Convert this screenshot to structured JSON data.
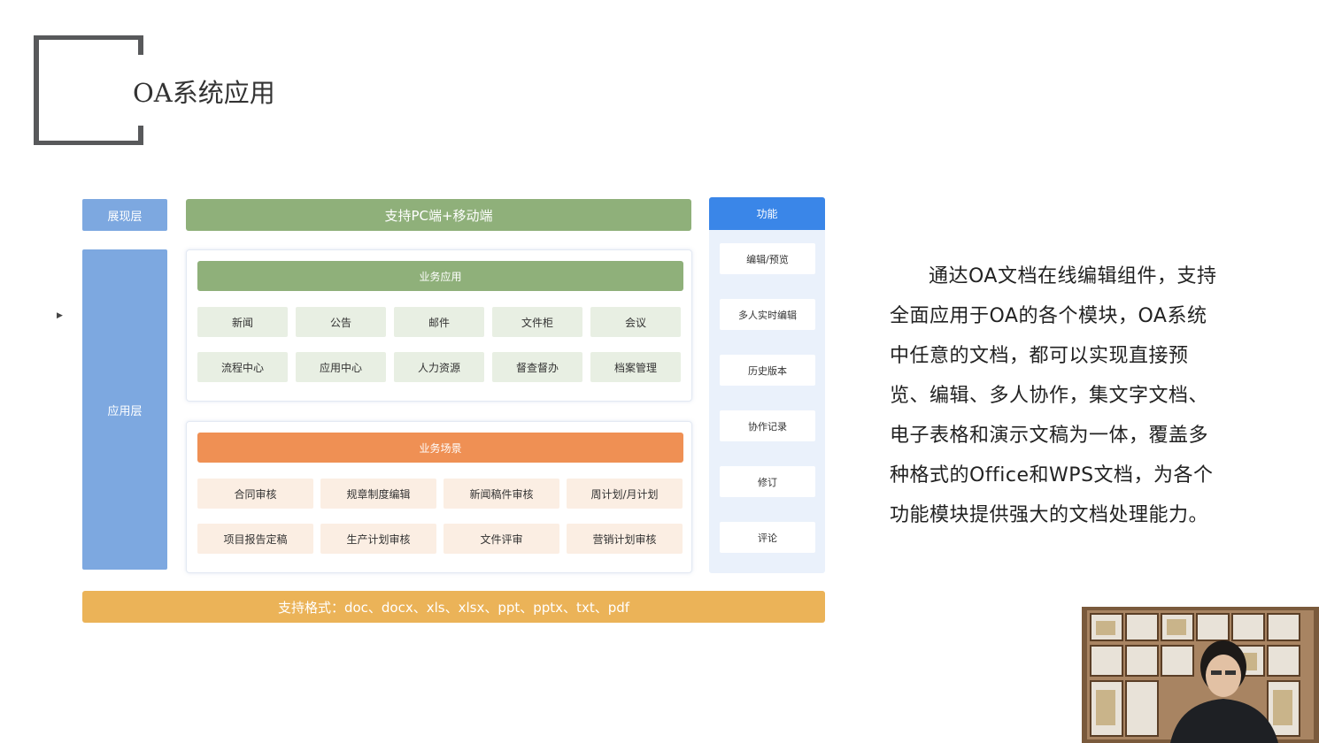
{
  "page": {
    "title": "OA系统应用"
  },
  "diagram": {
    "presentation_layer": "展现层",
    "application_layer": "应用层",
    "support_pc": "支持PC端+移动端",
    "business_apps": {
      "title": "业务应用",
      "items": [
        "新闻",
        "公告",
        "邮件",
        "文件柜",
        "会议",
        "流程中心",
        "应用中心",
        "人力资源",
        "督查督办",
        "档案管理"
      ]
    },
    "business_scenes": {
      "title": "业务场景",
      "items": [
        "合同审核",
        "规章制度编辑",
        "新闻稿件审核",
        "周计划/月计划",
        "项目报告定稿",
        "生产计划审核",
        "文件评审",
        "营销计划审核"
      ]
    },
    "functions": {
      "title": "功能",
      "items": [
        "编辑/预览",
        "多人实时编辑",
        "历史版本",
        "协作记录",
        "修订",
        "评论"
      ]
    },
    "formats": "支持格式：doc、docx、xls、xlsx、ppt、pptx、txt、pdf"
  },
  "description": "通达OA文档在线编辑组件，支持全面应用于OA的各个模块，OA系统中任意的文档，都可以实现直接预览、编辑、多人协作，集文字文档、电子表格和演示文稿为一体，覆盖多种格式的Office和WPS文档，为各个功能模块提供强大的文档处理能力。",
  "colors": {
    "blue_layer": "#7da8e0",
    "green": "#8fb07a",
    "orange": "#ef9054",
    "function_blue": "#3a86e8",
    "formats_gold": "#ebb358"
  }
}
